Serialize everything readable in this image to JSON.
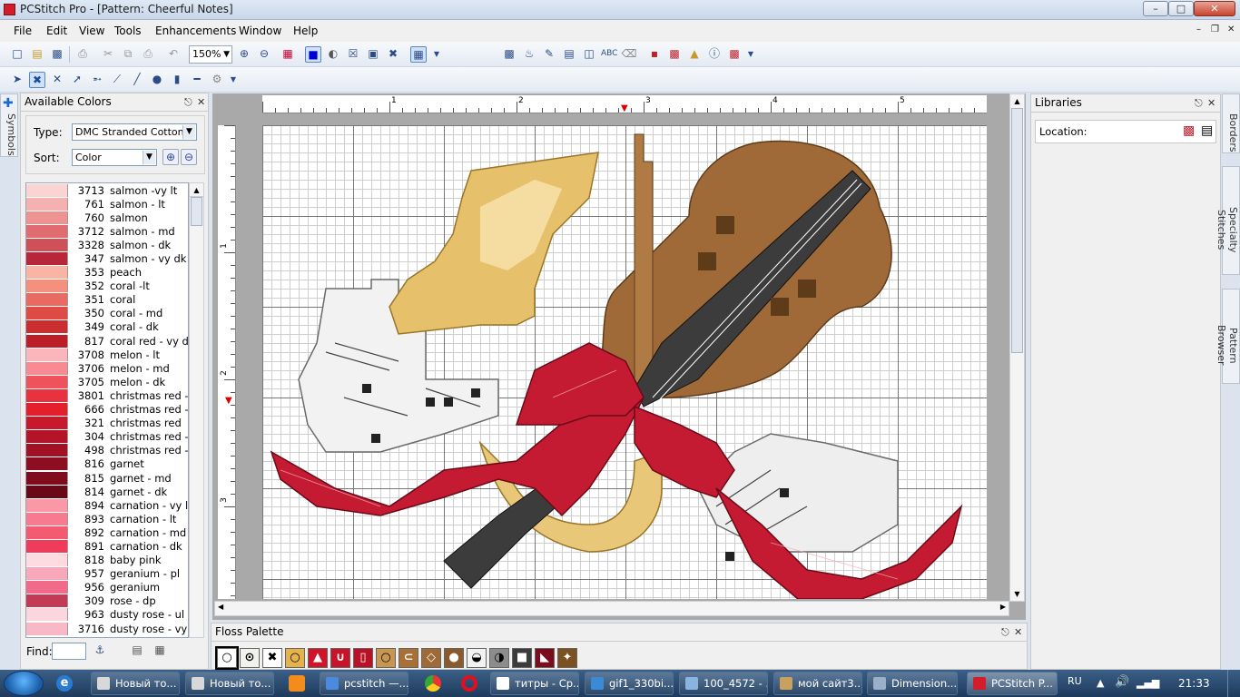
{
  "window": {
    "title": "PCStitch Pro - [Pattern: Cheerful Notes]",
    "min": "–",
    "max": "□",
    "close": "✕"
  },
  "menu": [
    "File",
    "Edit",
    "View",
    "Tools",
    "Enhancements",
    "Window",
    "Help"
  ],
  "mdi_controls": {
    "min": "–",
    "restore": "❐",
    "close": "✕"
  },
  "toolbar": {
    "zoom": "150%"
  },
  "left_panel": {
    "title": "Available Colors",
    "type_label": "Type:",
    "type_value": "DMC Stranded Cotton",
    "sort_label": "Sort:",
    "sort_value": "Color",
    "find_label": "Find:",
    "side_tab": "Symbols",
    "colors": [
      {
        "code": "3713",
        "name": "salmon -vy lt",
        "hex": "#fbd3d3"
      },
      {
        "code": "761",
        "name": "salmon - lt",
        "hex": "#f5b0b0"
      },
      {
        "code": "760",
        "name": "salmon",
        "hex": "#ee9292"
      },
      {
        "code": "3712",
        "name": "salmon - md",
        "hex": "#e06c70"
      },
      {
        "code": "3328",
        "name": "salmon - dk",
        "hex": "#cf5058"
      },
      {
        "code": "347",
        "name": "salmon - vy dk",
        "hex": "#b8263a"
      },
      {
        "code": "353",
        "name": "peach",
        "hex": "#f9b4a4"
      },
      {
        "code": "352",
        "name": "coral -lt",
        "hex": "#f4907e"
      },
      {
        "code": "351",
        "name": "coral",
        "hex": "#e86a62"
      },
      {
        "code": "350",
        "name": "coral - md",
        "hex": "#de4a44"
      },
      {
        "code": "349",
        "name": "coral - dk",
        "hex": "#cc2e30"
      },
      {
        "code": "817",
        "name": "coral red - vy d",
        "hex": "#bb1e26"
      },
      {
        "code": "3708",
        "name": "melon - lt",
        "hex": "#fbb6bc"
      },
      {
        "code": "3706",
        "name": "melon - md",
        "hex": "#f98a92"
      },
      {
        "code": "3705",
        "name": "melon - dk",
        "hex": "#f0525c"
      },
      {
        "code": "3801",
        "name": "christmas red -",
        "hex": "#e8323e"
      },
      {
        "code": "666",
        "name": "christmas red -",
        "hex": "#e31f2b"
      },
      {
        "code": "321",
        "name": "christmas red",
        "hex": "#c8182c"
      },
      {
        "code": "304",
        "name": "christmas red -",
        "hex": "#b41428"
      },
      {
        "code": "498",
        "name": "christmas red -",
        "hex": "#a31224"
      },
      {
        "code": "816",
        "name": "garnet",
        "hex": "#8c0e20"
      },
      {
        "code": "815",
        "name": "garnet - md",
        "hex": "#7e0c1c"
      },
      {
        "code": "814",
        "name": "garnet - dk",
        "hex": "#6a0818"
      },
      {
        "code": "894",
        "name": "carnation - vy lt",
        "hex": "#fb98a8"
      },
      {
        "code": "893",
        "name": "carnation - lt",
        "hex": "#f87a8e"
      },
      {
        "code": "892",
        "name": "carnation - md",
        "hex": "#f45a70"
      },
      {
        "code": "891",
        "name": "carnation - dk",
        "hex": "#f03c5a"
      },
      {
        "code": "818",
        "name": "baby pink",
        "hex": "#fddbe0"
      },
      {
        "code": "957",
        "name": "geranium - pl",
        "hex": "#f9a8bc"
      },
      {
        "code": "956",
        "name": "geranium",
        "hex": "#f26a8a"
      },
      {
        "code": "309",
        "name": "rose - dp",
        "hex": "#c23a56"
      },
      {
        "code": "963",
        "name": "dusty rose - ul v",
        "hex": "#fcd6de"
      },
      {
        "code": "3716",
        "name": "dusty rose - vy l",
        "hex": "#f8b8c6"
      }
    ]
  },
  "ruler": {
    "top": [
      "1",
      "2",
      "3",
      "4",
      "5"
    ],
    "left": [
      "1",
      "2",
      "3"
    ]
  },
  "floss_palette": {
    "title": "Floss Palette",
    "symbols": [
      {
        "glyph": "○",
        "bg": "#ffffff",
        "fg": "#000"
      },
      {
        "glyph": "⊙",
        "bg": "#f2f2ec",
        "fg": "#000"
      },
      {
        "glyph": "✖",
        "bg": "#ffffff",
        "fg": "#000"
      },
      {
        "glyph": "○",
        "bg": "#e6b24a",
        "fg": "#000"
      },
      {
        "glyph": "▲",
        "bg": "#d0142a",
        "fg": "#fff"
      },
      {
        "glyph": "∪",
        "bg": "#c8142a",
        "fg": "#fff"
      },
      {
        "glyph": "▯",
        "bg": "#b91226",
        "fg": "#fff"
      },
      {
        "glyph": "○",
        "bg": "#c99650",
        "fg": "#000"
      },
      {
        "glyph": "⊂",
        "bg": "#a87034",
        "fg": "#fff"
      },
      {
        "glyph": "◇",
        "bg": "#a06a36",
        "fg": "#fff"
      },
      {
        "glyph": "●",
        "bg": "#8a5a2c",
        "fg": "#fff"
      },
      {
        "glyph": "◒",
        "bg": "#f2f2f2",
        "fg": "#000"
      },
      {
        "glyph": "◑",
        "bg": "#8c8c8c",
        "fg": "#000"
      },
      {
        "glyph": "■",
        "bg": "#3c3c3c",
        "fg": "#fff"
      },
      {
        "glyph": "◣",
        "bg": "#7a0c1e",
        "fg": "#fff"
      },
      {
        "glyph": "✦",
        "bg": "#7c5020",
        "fg": "#fff"
      }
    ]
  },
  "libraries": {
    "title": "Libraries",
    "location_label": "Location:"
  },
  "right_tabs": [
    "Borders",
    "Specialty Stitches",
    "Pattern Browser"
  ],
  "taskbar": {
    "items": [
      {
        "label": "Новый то...",
        "color": "#d8d8d8"
      },
      {
        "label": "Новый то...",
        "color": "#d8d8d8"
      },
      {
        "label": "pcstitch —...",
        "color": "#4a8be0"
      },
      {
        "label": "титры - Ср...",
        "color": "#ffffff"
      },
      {
        "label": "gif1_330bi...",
        "color": "#3a8ad6"
      },
      {
        "label": "100_4572 - ...",
        "color": "#8ab4e0"
      },
      {
        "label": "мой сайт3...",
        "color": "#c8a060"
      },
      {
        "label": "Dimension...",
        "color": "#9ab0c8"
      },
      {
        "label": "PCStitch P...",
        "color": "#d21e2a"
      }
    ],
    "lang": "RU",
    "time": "21:33"
  }
}
